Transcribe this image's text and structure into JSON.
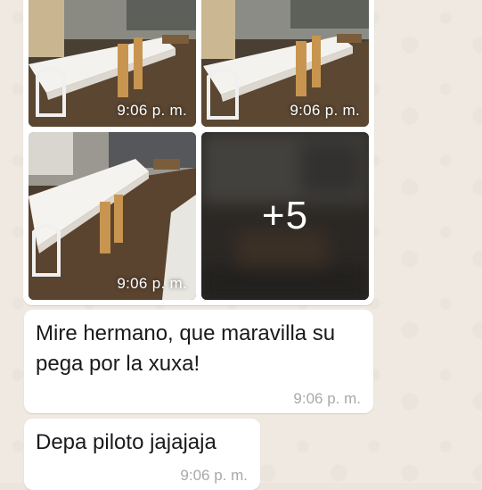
{
  "album": {
    "photos": [
      {
        "time": "9:06 p. m."
      },
      {
        "time": "9:06 p. m."
      },
      {
        "time": "9:06 p. m."
      },
      {
        "more_label": "+5"
      }
    ]
  },
  "messages": [
    {
      "text": "Mire hermano, que maravilla su pega por la xuxa!",
      "time": "9:06 p. m."
    },
    {
      "text": "Depa piloto jajajaja",
      "time": "9:06 p. m."
    }
  ],
  "colors": {
    "chat_background": "#efe9e1",
    "bubble": "#ffffff",
    "timestamp": "#a9a9a9"
  }
}
